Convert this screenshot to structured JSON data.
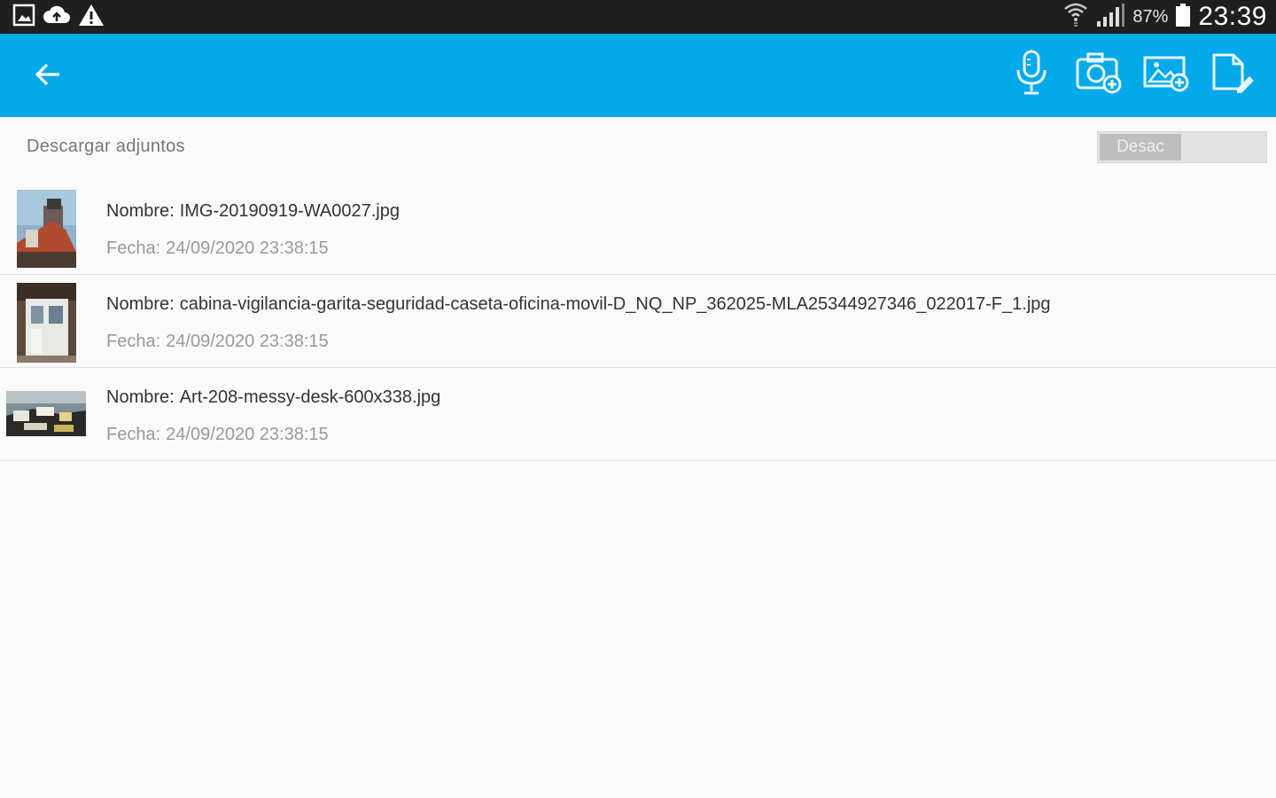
{
  "status_bar": {
    "icons_left": [
      "gallery-icon",
      "cloud-upload-icon",
      "warning-icon"
    ],
    "battery": "87%",
    "time": "23:39"
  },
  "toolbar": {
    "background": "#03a9e8",
    "back_icon": "arrow-back-icon",
    "actions": [
      "microphone-icon",
      "camera-add-icon",
      "image-add-icon",
      "file-edit-icon"
    ]
  },
  "download": {
    "label": "Descargar adjuntos",
    "toggle_label": "Desac"
  },
  "attachments": [
    {
      "name_label": "Nombre:",
      "name": "IMG-20190919-WA0027.jpg",
      "date_label": "Fecha:",
      "date": "24/09/2020 23:38:15"
    },
    {
      "name_label": "Nombre:",
      "name": "cabina-vigilancia-garita-seguridad-caseta-oficina-movil-D_NQ_NP_362025-MLA25344927346_022017-F_1.jpg",
      "date_label": "Fecha:",
      "date": "24/09/2020 23:38:15"
    },
    {
      "name_label": "Nombre:",
      "name": "Art-208-messy-desk-600x338.jpg",
      "date_label": "Fecha:",
      "date": "24/09/2020 23:38:15"
    }
  ]
}
